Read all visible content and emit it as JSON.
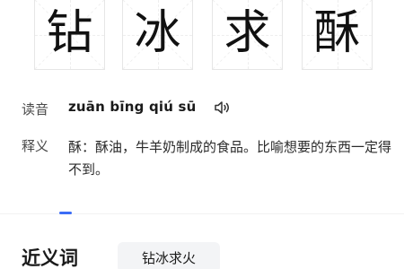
{
  "characters": [
    "钻",
    "冰",
    "求",
    "酥"
  ],
  "pronunciation": {
    "label": "读音",
    "pinyin": "zuān bīng qiú sū"
  },
  "definition": {
    "label": "释义",
    "text": "酥：酥油，牛羊奶制成的食品。比喻想要的东西一定得不到。"
  },
  "synonyms": {
    "title": "近义词",
    "items": [
      "钻冰求火"
    ]
  },
  "colors": {
    "accent": "#3b6cf6"
  }
}
